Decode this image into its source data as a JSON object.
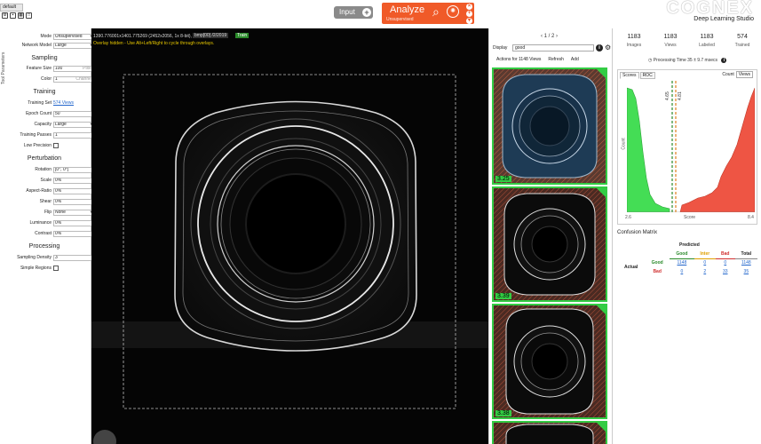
{
  "topbar": {
    "tab_label": "default",
    "input_label": "Input",
    "analyze_label": "Analyze",
    "analyze_sub": "Unsupervised",
    "brand_name": "COGNEX",
    "brand_sub": "Deep Learning Studio"
  },
  "left_panel": {
    "side_tab": "Tool Parameters",
    "mode_label": "Mode",
    "mode_value": "Unsupervised",
    "network_label": "Network Model",
    "network_value": "Large",
    "sampling_head": "Sampling",
    "feature_label": "Feature Size",
    "feature_value": "100",
    "feature_unit": "Pixel",
    "color_label": "Color",
    "color_value": "1",
    "color_unit": "Channel",
    "training_head": "Training",
    "trainset_label": "Training Set",
    "trainset_value": "574 Views",
    "epoch_label": "Epoch Count",
    "epoch_value": "50",
    "capacity_label": "Capacity",
    "capacity_value": "Large",
    "passes_label": "Training Passes",
    "passes_value": "1",
    "lowprec_label": "Low Precision",
    "perturb_head": "Perturbation",
    "rotation_label": "Rotation",
    "rotation_value": "[0°, 0°]",
    "scale_label": "Scale",
    "scale_value": "0%",
    "aspect_label": "Aspect-Ratio",
    "aspect_value": "0%",
    "shear_label": "Shear",
    "shear_value": "0%",
    "flip_label": "Flip",
    "flip_value": "None",
    "lum_label": "Luminance",
    "lum_value": "0%",
    "contrast_label": "Contrast",
    "contrast_value": "0%",
    "processing_head": "Processing",
    "density_label": "Sampling Density",
    "density_value": "3",
    "simple_label": "Simple Regions"
  },
  "viewer": {
    "info_line": "1390.776001x1401.775269 (2452x2056, 1x 8-bit), Zoom 0.6x",
    "overlay_line": "Overlay hidden - Use Alt+Left/Right to cycle through overlays.",
    "date_label": "bmp[00]  /2/2019",
    "train_badge": "Train"
  },
  "thumbs": {
    "pager": "1 / 2",
    "display_label": "Display",
    "display_value": "good",
    "actions_label": "Actions for 1148 Views",
    "refresh_label": "Refresh",
    "add_label": "Add",
    "scores": [
      "3.25",
      "3.39",
      "3.38",
      ""
    ]
  },
  "stats": {
    "items": [
      {
        "value": "1183",
        "label": "Images"
      },
      {
        "value": "1183",
        "label": "Views"
      },
      {
        "value": "1183",
        "label": "Labeled"
      },
      {
        "value": "574",
        "label": "Trained"
      }
    ],
    "processing_time": "Processing Time 35 ± 9.7 msecs",
    "tab_scores": "Scores",
    "tab_roc": "ROC",
    "count_label": "Count",
    "count_value": "Views",
    "y_label": "Count",
    "x_label": "Score",
    "x_min": "2.6",
    "x_max": "8.4",
    "thresh1": "4.65",
    "thresh2": "4.81"
  },
  "confusion": {
    "title": "Confusion Matrix",
    "predicted": "Predicted",
    "actual": "Actual",
    "col_good": "Good",
    "col_inter": "Inter",
    "col_bad": "Bad",
    "col_total": "Total",
    "rows": [
      {
        "label": "Good",
        "good": "1148",
        "inter": "0",
        "bad": "0",
        "total": "1148"
      },
      {
        "label": "Bad",
        "good": "0",
        "inter": "2",
        "bad": "33",
        "total": "35"
      }
    ]
  },
  "chart_data": {
    "type": "area",
    "xlabel": "Score",
    "ylabel": "Count",
    "xlim": [
      2.6,
      8.4
    ],
    "thresholds": [
      4.65,
      4.81
    ],
    "series": [
      {
        "name": "Good",
        "color": "#44dd55"
      },
      {
        "name": "Bad",
        "color": "#ee5544"
      }
    ]
  },
  "colors": {
    "accent": "#f05a28",
    "good": "#33cc44",
    "bad": "#ee5544",
    "link": "#2266cc"
  }
}
